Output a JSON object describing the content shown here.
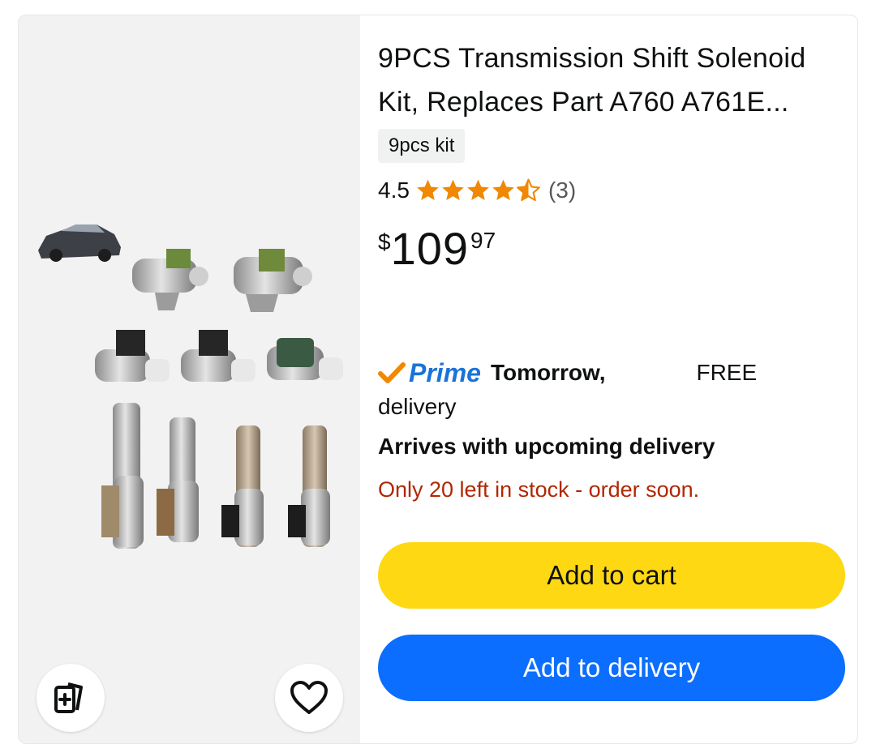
{
  "product": {
    "title": "9PCS Transmission Shift Solenoid Kit, Replaces Part A760 A761E...",
    "variant": "9pcs kit",
    "rating": {
      "value": "4.5",
      "stars": 4.5,
      "count": "(3)"
    },
    "price": {
      "symbol": "$",
      "whole": "109",
      "fraction": "97"
    }
  },
  "delivery": {
    "prime_label": "Prime",
    "day": "Tomorrow,",
    "free": "FREE",
    "label": "delivery",
    "arrives": "Arrives with upcoming delivery",
    "stock": "Only 20 left in stock - order soon."
  },
  "actions": {
    "add_to_cart": "Add to cart",
    "add_to_delivery": "Add to delivery"
  },
  "icons": {
    "compare": "compare-icon",
    "wishlist": "heart-icon",
    "prime": "check-icon"
  },
  "colors": {
    "star": "#f08804",
    "prime_blue": "#1a74d8",
    "stock_red": "#b12704",
    "cart_yellow": "#ffd814",
    "delivery_blue": "#0b6efe"
  }
}
